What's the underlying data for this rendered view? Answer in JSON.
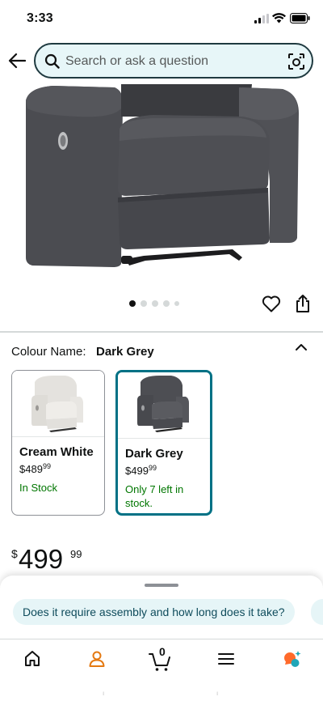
{
  "status_bar": {
    "time": "3:33"
  },
  "search": {
    "placeholder": "Search or ask a question"
  },
  "carousel": {
    "total": 5,
    "active_index": 0
  },
  "colour": {
    "label": "Colour Name:",
    "value": "Dark Grey"
  },
  "variants": [
    {
      "name": "Cream White",
      "currency": "$",
      "price_whole": "489",
      "price_fraction": "99",
      "stock": "In Stock"
    },
    {
      "name": "Dark Grey",
      "currency": "$",
      "price_whole": "499",
      "price_fraction": "99",
      "stock": "Only 7 left in stock."
    }
  ],
  "price": {
    "currency": "$",
    "whole": "499",
    "fraction": "99"
  },
  "suggestions": [
    "Does it require assembly and how long does it take?"
  ],
  "tab_bar": {
    "cart_count": "0",
    "footer_marks": [
      "ı",
      "ı"
    ]
  },
  "colors": {
    "accent_teal": "#007185",
    "in_stock_green": "#007600",
    "account_orange": "#e47911",
    "search_bg": "#e7f6f8"
  },
  "icons": [
    "back-arrow-icon",
    "search-icon",
    "camera-icon",
    "heart-icon",
    "share-icon",
    "chevron-up-icon",
    "home-icon",
    "account-icon",
    "cart-icon",
    "menu-icon",
    "rufus-icon"
  ]
}
